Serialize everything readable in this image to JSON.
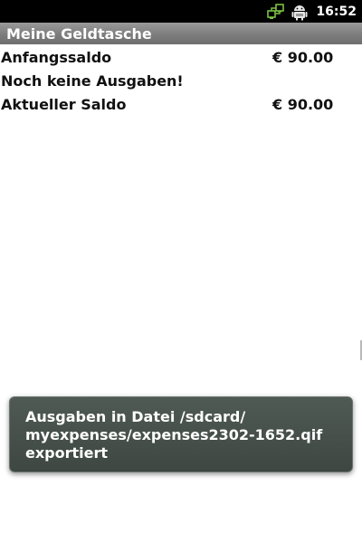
{
  "status_bar": {
    "time": "16:52",
    "icons": [
      "network-sync-icon",
      "android-usb-icon"
    ],
    "accent_color": "#7ac142"
  },
  "title_bar": {
    "title": "Meine Geldtasche"
  },
  "summary": {
    "start_balance_label": "Anfangssaldo",
    "start_balance_value": "€ 90.00",
    "no_expenses_text": "Noch keine Ausgaben!",
    "current_balance_label": "Aktueller Saldo",
    "current_balance_value": "€ 90.00"
  },
  "toast": {
    "message": "Ausgaben in Datei /sdcard/\nmyexpenses/expenses2302-1652.qif\nexportiert"
  }
}
